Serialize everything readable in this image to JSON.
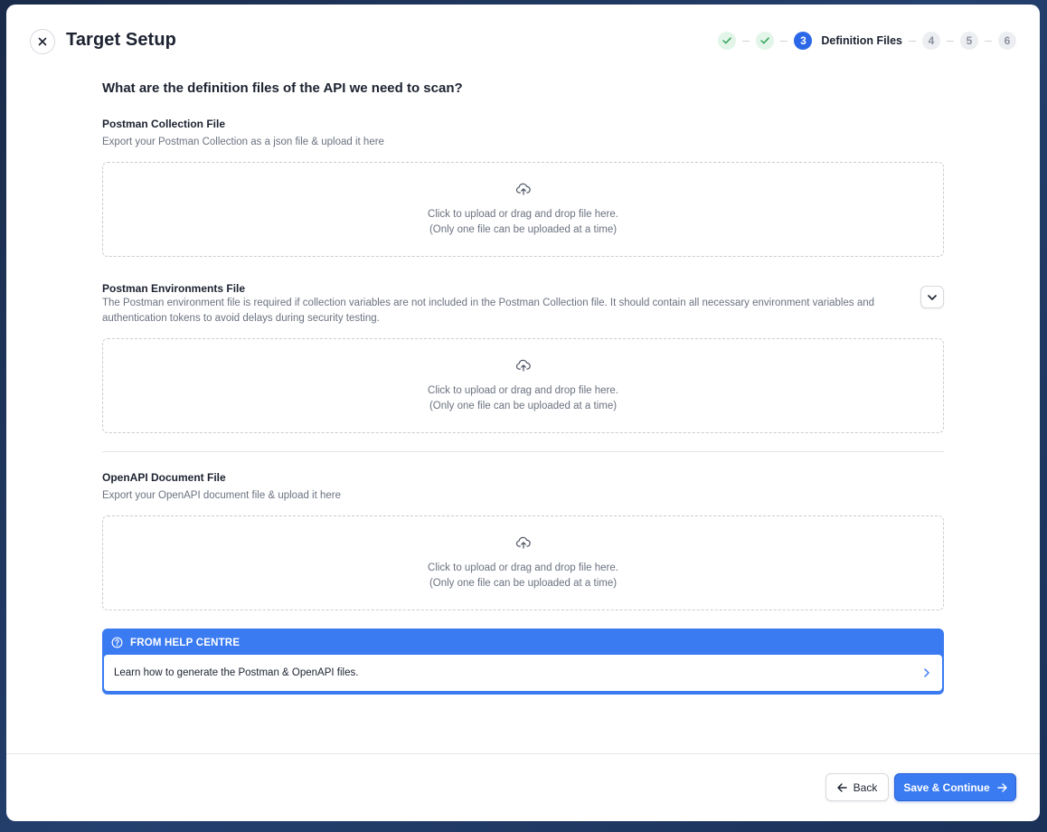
{
  "header": {
    "title": "Target Setup",
    "close_icon": "close-icon"
  },
  "stepper": {
    "steps": [
      {
        "number": "1",
        "status": "completed",
        "icon": "check-icon"
      },
      {
        "number": "2",
        "status": "completed",
        "icon": "check-icon"
      },
      {
        "number": "3",
        "status": "current",
        "label": "Definition Files"
      },
      {
        "number": "4",
        "status": "upcoming"
      },
      {
        "number": "5",
        "status": "upcoming"
      },
      {
        "number": "6",
        "status": "upcoming"
      }
    ]
  },
  "main": {
    "question": "What are the definition files of the API we need to scan?",
    "sections": [
      {
        "title": "Postman Collection File",
        "description": "Export your Postman Collection as a json file & upload it here",
        "dropzone": {
          "icon": "cloud-upload-icon",
          "line1": "Click to upload or drag and drop file here.",
          "line2": "(Only one file can be uploaded at a time)"
        }
      },
      {
        "title": "Postman Environments File",
        "description": "The Postman environment file is required if collection variables are not included in the Postman Collection file. It should contain all necessary environment variables and authentication tokens to avoid delays during security testing.",
        "expand_icon": "chevron-down-icon",
        "dropzone": {
          "icon": "cloud-upload-icon",
          "line1": "Click to upload or drag and drop file here.",
          "line2": "(Only one file can be uploaded at a time)"
        }
      },
      {
        "title": "OpenAPI Document File",
        "description": "Export your OpenAPI document file & upload it here",
        "dropzone": {
          "icon": "cloud-upload-icon",
          "line1": "Click to upload or drag and drop file here.",
          "line2": "(Only one file can be uploaded at a time)"
        }
      }
    ],
    "help": {
      "heading": "FROM HELP CENTRE",
      "icon": "help-circle-icon",
      "link_text": "Learn how to generate the Postman & OpenAPI files.",
      "link_icon": "chevron-right-icon"
    }
  },
  "footer": {
    "back_label": "Back",
    "save_label": "Save & Continue"
  },
  "colors": {
    "accent": "#3a7bf2",
    "step_done_bg": "#e2f5e8",
    "step_done_check": "#2fa35a",
    "text_muted": "#6b7280"
  }
}
